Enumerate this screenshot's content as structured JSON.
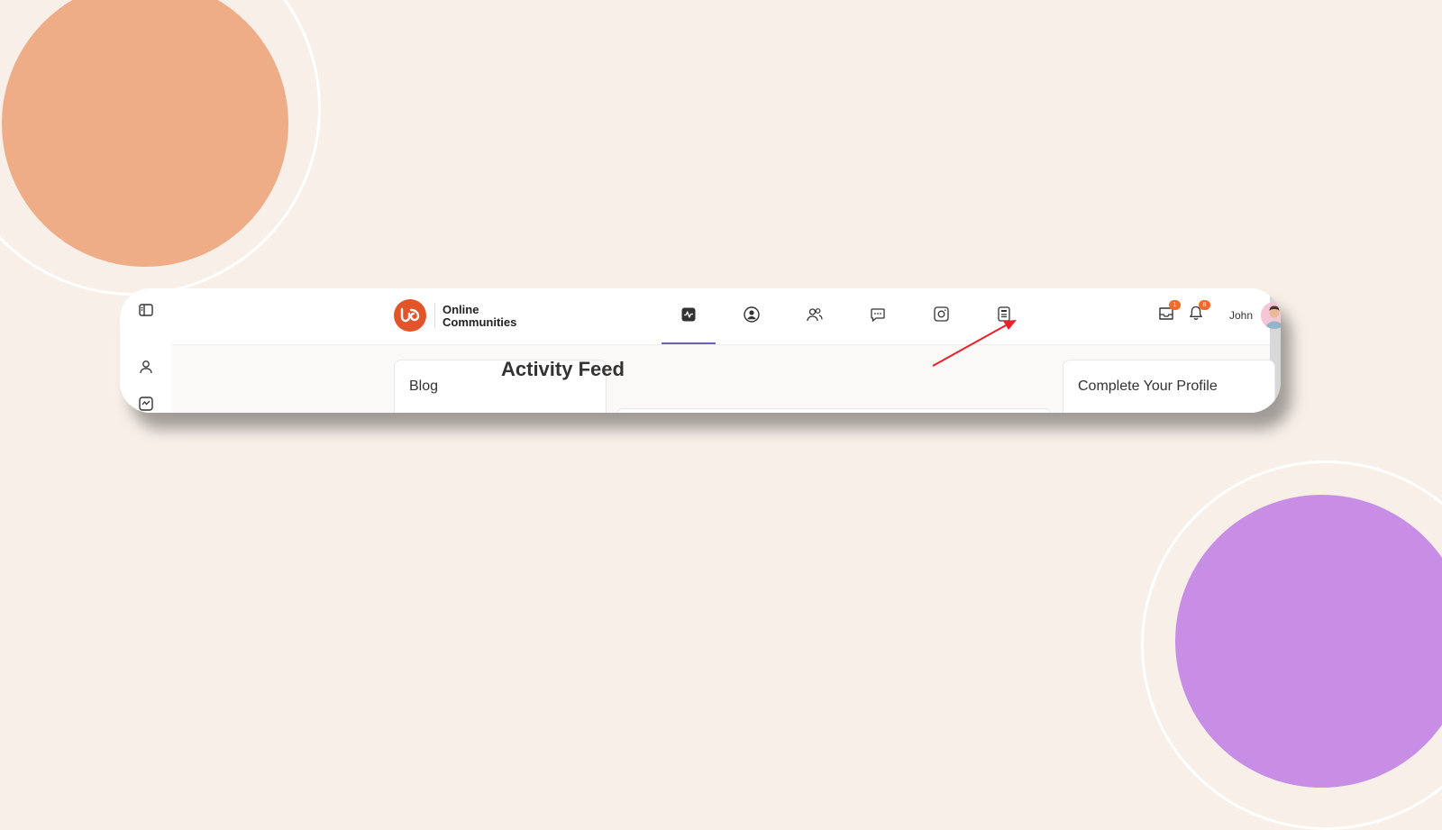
{
  "colors": {
    "background": "#f7efe8",
    "accent_orange": "#efad87",
    "accent_purple": "#c88ee6",
    "brand": "#e2552b",
    "badge": "#f26b2b",
    "active_tab": "#6c5fb5",
    "annotation_arrow": "#e8212a"
  },
  "brand": {
    "line1": "Online",
    "line2": "Communities",
    "logo_icon": "buddyboss-logo-icon"
  },
  "sidebar_rail": {
    "items": [
      {
        "icon": "sidebar-toggle-icon"
      },
      {
        "icon": "user-icon"
      },
      {
        "icon": "activity-icon"
      }
    ]
  },
  "nav": {
    "tabs": [
      {
        "icon": "activity-pulse-icon",
        "active": true
      },
      {
        "icon": "profile-circle-icon",
        "active": false
      },
      {
        "icon": "members-icon",
        "active": false
      },
      {
        "icon": "messages-icon",
        "active": false
      },
      {
        "icon": "photos-icon",
        "active": false
      },
      {
        "icon": "documents-icon",
        "active": false
      }
    ]
  },
  "header": {
    "inbox_icon": "inbox-icon",
    "inbox_badge": "1",
    "notifications_icon": "bell-icon",
    "notifications_badge": "8",
    "user_name": "John"
  },
  "main": {
    "left_panel_title": "Blog",
    "page_title": "Activity Feed",
    "right_panel_title": "Complete Your Profile"
  }
}
